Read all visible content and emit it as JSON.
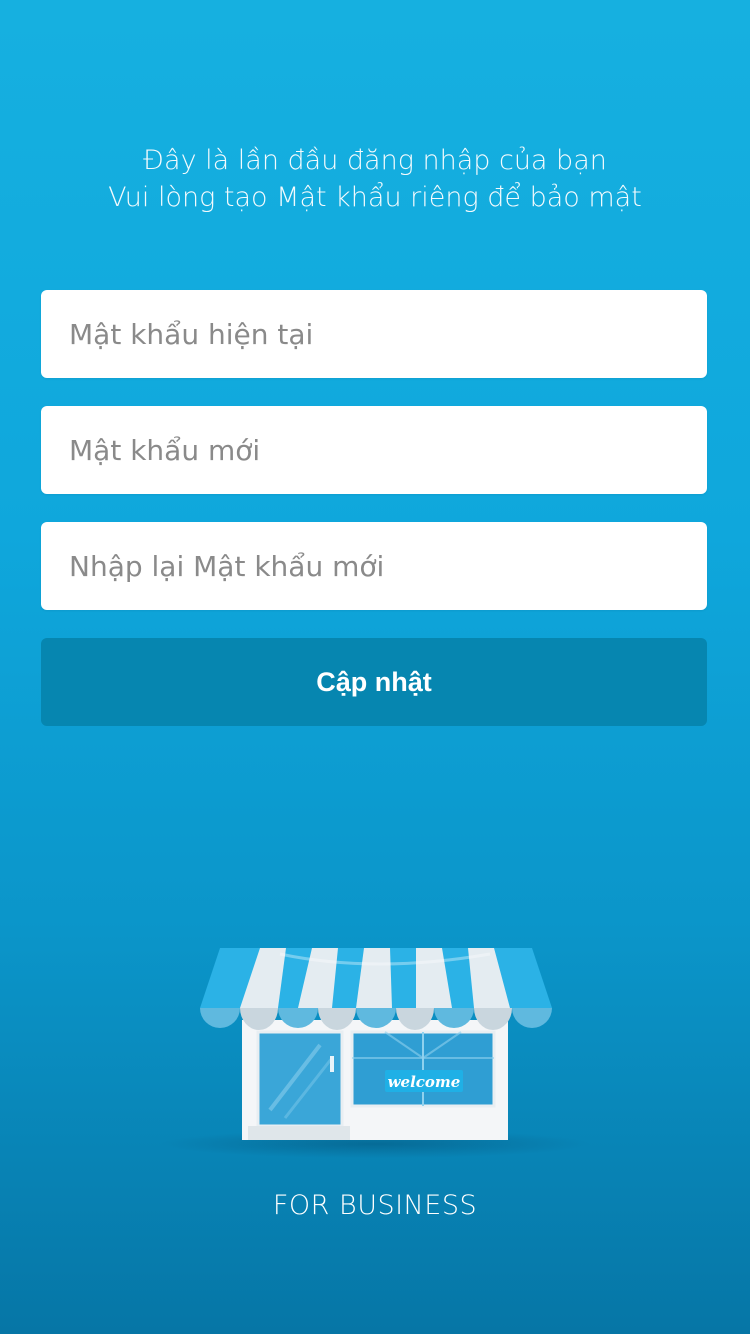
{
  "intro": {
    "line1": "Đây là lần đầu đăng nhập của bạn",
    "line2": "Vui lòng tạo Mật khẩu riêng để bảo mật"
  },
  "form": {
    "current_password": {
      "placeholder": "Mật khẩu hiện tại",
      "value": ""
    },
    "new_password": {
      "placeholder": "Mật khẩu mới",
      "value": ""
    },
    "confirm_password": {
      "placeholder": "Nhập lại Mật khẩu mới",
      "value": ""
    },
    "submit_label": "Cập nhật"
  },
  "illustration": {
    "icon": "storefront-illustration",
    "sign_text": "welcome"
  },
  "footer": {
    "tagline": "FOR BUSINESS"
  },
  "colors": {
    "background_top": "#16b0e0",
    "background_bottom": "#0676a6",
    "button": "#0686b0"
  }
}
